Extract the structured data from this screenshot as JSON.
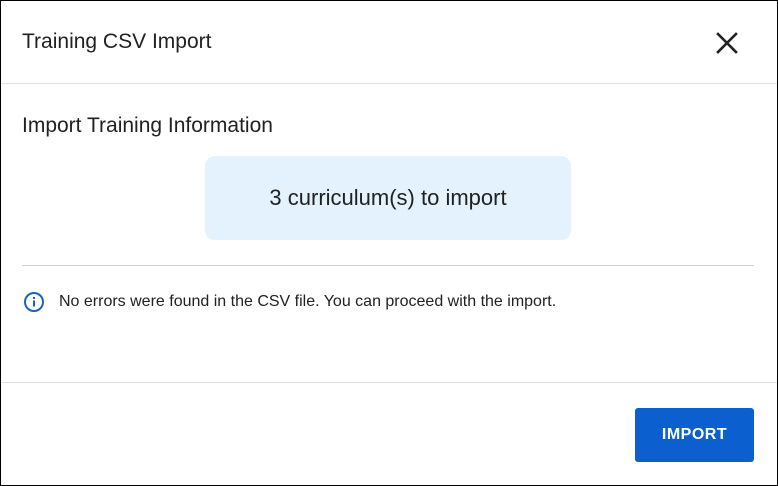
{
  "dialog": {
    "title": "Training CSV Import",
    "close_icon": "close-icon"
  },
  "content": {
    "section_title": "Import Training Information",
    "summary": "3 curriculum(s) to import",
    "info_icon": "info-icon",
    "info_message": "No errors were found in the CSV file. You can proceed with the import."
  },
  "footer": {
    "import_label": "IMPORT"
  },
  "colors": {
    "primary": "#0b5fcf",
    "summary_background": "#e3f2fd",
    "info_icon": "#1565c0"
  }
}
